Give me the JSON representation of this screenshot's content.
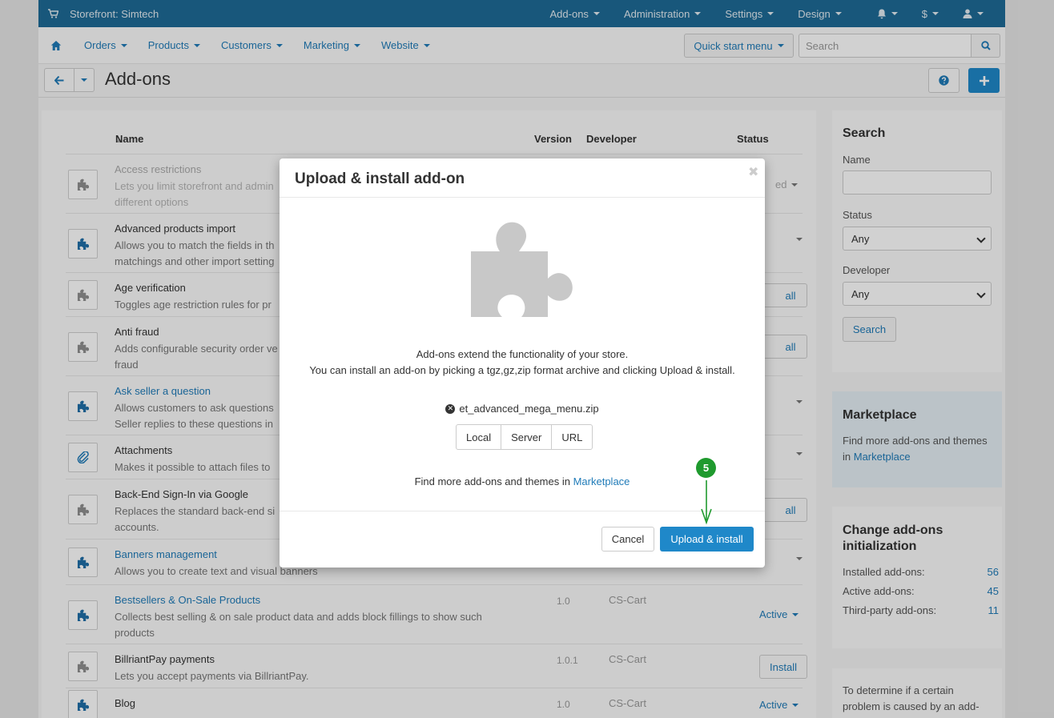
{
  "topbar": {
    "store_title": "Storefront: Simtech",
    "menu": [
      "Add-ons",
      "Administration",
      "Settings",
      "Design",
      "$"
    ]
  },
  "nav": {
    "items": [
      "Orders",
      "Products",
      "Customers",
      "Marketing",
      "Website"
    ],
    "quick_start": "Quick start menu",
    "search_placeholder": "Search"
  },
  "page": {
    "title": "Add-ons"
  },
  "table": {
    "headers": {
      "name": "Name",
      "version": "Version",
      "developer": "Developer",
      "status": "Status"
    },
    "rows": [
      {
        "name": "Access restrictions",
        "desc": "Lets you limit storefront and admin",
        "desc2": "different options"
      },
      {
        "name": "Advanced products import",
        "desc": "Allows you to match the fields in th",
        "desc2": "matchings and other import setting"
      },
      {
        "name": "Age verification",
        "desc": "Toggles age restriction rules for pr",
        "desc2": ""
      },
      {
        "name": "Anti fraud",
        "desc": "Adds configurable security order ve",
        "desc2": "fraud"
      },
      {
        "name": "Ask seller a question",
        "desc": "Allows customers to ask questions",
        "desc2": "Seller replies to these questions in"
      },
      {
        "name": "Attachments",
        "desc": "Makes it possible to attach files to",
        "desc2": ""
      },
      {
        "name": "Back-End Sign-In via Google",
        "desc": "Replaces the standard back-end si",
        "desc2": "accounts."
      },
      {
        "name": "Banners management",
        "desc": "Allows you to create text and visual banners",
        "desc2": ""
      },
      {
        "name": "Bestsellers & On-Sale Products",
        "desc": "Collects best selling & on sale product data and adds block fillings to show such",
        "desc2": "products",
        "version": "1.0",
        "developer": "CS-Cart",
        "status": "Active"
      },
      {
        "name": "BillriantPay payments",
        "desc": "Lets you accept payments via BillriantPay.",
        "desc2": "",
        "version": "1.0.1",
        "developer": "CS-Cart",
        "status": "Install"
      },
      {
        "name": "Blog",
        "desc": "",
        "desc2": "",
        "version": "1.0",
        "developer": "CS-Cart",
        "status": "Active"
      }
    ],
    "partial_status": {
      "dropdown_suffix": "ed",
      "install_suffix": "all"
    }
  },
  "sidebar": {
    "search": {
      "title": "Search",
      "name_label": "Name",
      "status_label": "Status",
      "status_value": "Any",
      "developer_label": "Developer",
      "developer_value": "Any",
      "button": "Search"
    },
    "marketplace": {
      "title": "Marketplace",
      "text": "Find more add-ons and themes",
      "text_in": "in",
      "link": "Marketplace"
    },
    "init": {
      "title_line1": "Change add-ons",
      "title_line2": "initialization",
      "stats": [
        {
          "label": "Installed add-ons:",
          "value": "56"
        },
        {
          "label": "Active add-ons:",
          "value": "45"
        },
        {
          "label": "Third-party add-ons:",
          "value": "11"
        }
      ]
    },
    "help": {
      "line1": "To determine if a certain",
      "line2": "problem is caused by an add-"
    }
  },
  "modal": {
    "title": "Upload & install add-on",
    "desc1": "Add-ons extend the functionality of your store.",
    "desc2": "You can install an add-on by picking a tgz,gz,zip format archive and clicking Upload & install.",
    "file_name": "et_advanced_mega_menu.zip",
    "sources": [
      "Local",
      "Server",
      "URL"
    ],
    "marketplace_text": "Find more add-ons and themes in",
    "marketplace_link": "Marketplace",
    "cancel": "Cancel",
    "upload": "Upload & install"
  },
  "step_marker": "5",
  "colors": {
    "primary": "#1f88c9",
    "topbar": "#1e6b96",
    "link": "#1f7bb8",
    "step": "#1f9a2e"
  }
}
